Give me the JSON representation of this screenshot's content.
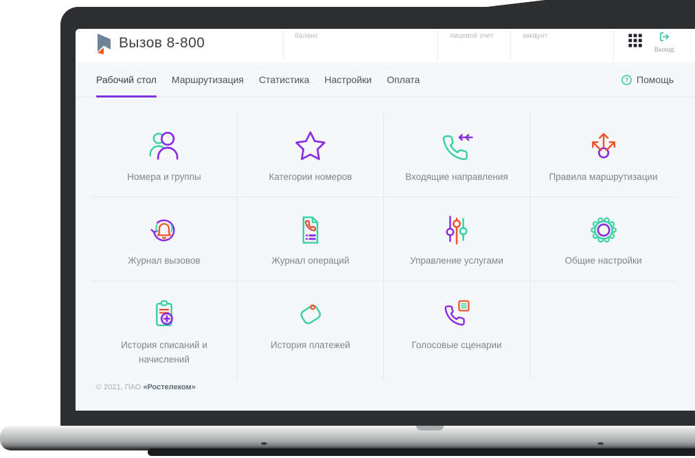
{
  "header": {
    "logo": "rostelecom-logo",
    "app_title": "Вызов 8-800",
    "account_fields": [
      {
        "label": "баланс"
      },
      {
        "label": "лицевой счет"
      },
      {
        "label": "аккаунт"
      }
    ],
    "apps_icon": "grid-apps-icon",
    "logout_label": "Выход"
  },
  "nav": {
    "tabs": [
      {
        "label": "Рабочий стол",
        "active": true
      },
      {
        "label": "Маршрутизация",
        "active": false
      },
      {
        "label": "Статистика",
        "active": false
      },
      {
        "label": "Настройки",
        "active": false
      },
      {
        "label": "Оплата",
        "active": false
      }
    ],
    "help_label": "Помощь"
  },
  "tiles": [
    {
      "label": "Номера и группы",
      "icon": "users-icon"
    },
    {
      "label": "Категории номеров",
      "icon": "star-icon"
    },
    {
      "label": "Входящие направления",
      "icon": "incoming-call-icon"
    },
    {
      "label": "Правила маршрутизации",
      "icon": "routing-arrows-icon"
    },
    {
      "label": "Журнал вызовов",
      "icon": "call-log-bell-icon"
    },
    {
      "label": "Журнал операций",
      "icon": "operations-log-icon"
    },
    {
      "label": "Управление услугами",
      "icon": "services-sliders-icon"
    },
    {
      "label": "Общие настройки",
      "icon": "settings-gear-icon"
    },
    {
      "label": "История списаний и начислений",
      "icon": "charges-history-icon"
    },
    {
      "label": "История платежей",
      "icon": "payments-wallet-icon"
    },
    {
      "label": "Голосовые сценарии",
      "icon": "voice-scenarios-icon"
    }
  ],
  "footer": {
    "copyright": "© 2021, ПАО ",
    "company": "«Ростелеком»"
  },
  "colors": {
    "purple": "#8a2be2",
    "teal": "#3bd0a2",
    "orange": "#f0542b",
    "red": "#e0442e",
    "accent": "#7b2fe0"
  }
}
